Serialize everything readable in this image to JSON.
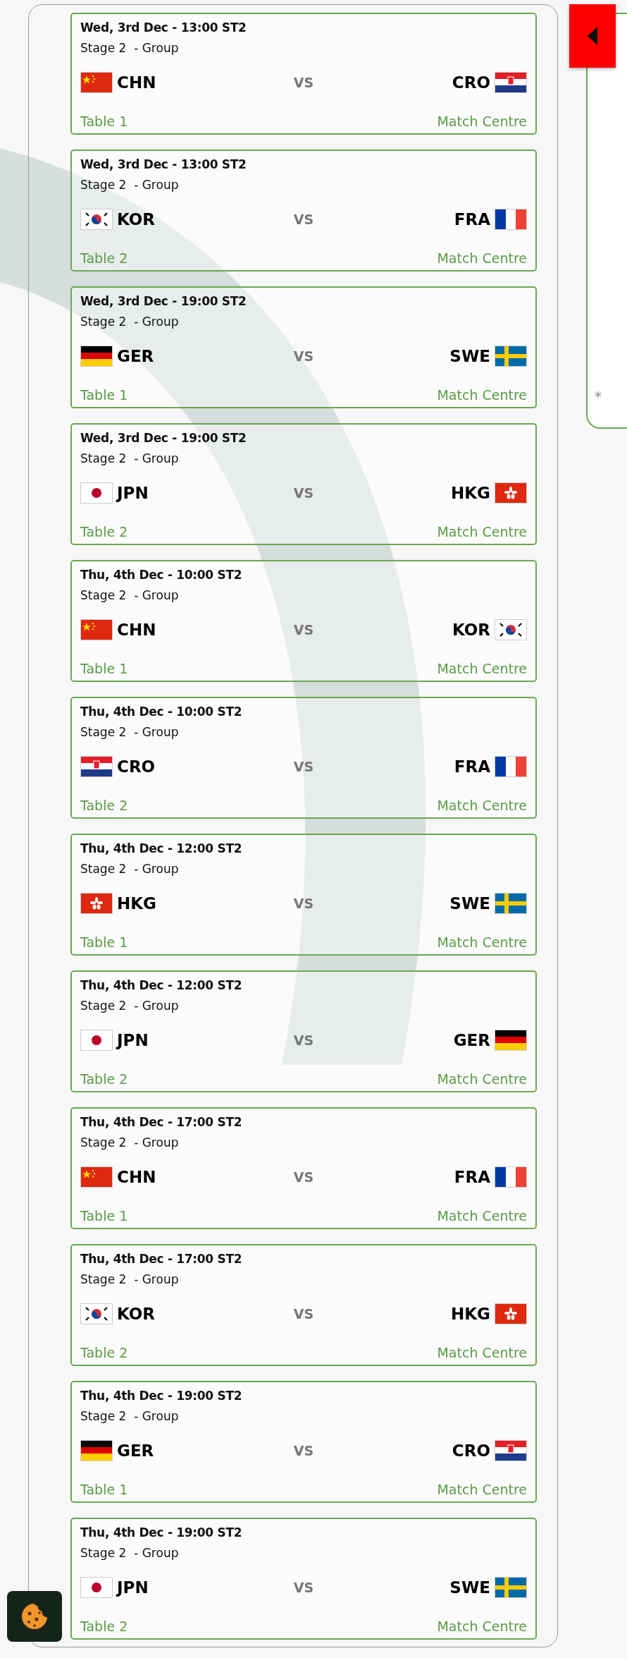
{
  "matches": [
    {
      "date": "Wed, 3rd Dec - 13:00 ST2",
      "stage": "Stage 2  - Group",
      "home": {
        "code": "CHN",
        "kind": "cn"
      },
      "vs": "VS",
      "away": {
        "code": "CRO",
        "kind": "hr"
      },
      "table": "Table 1",
      "link": "Match Centre"
    },
    {
      "date": "Wed, 3rd Dec - 13:00 ST2",
      "stage": "Stage 2  - Group",
      "home": {
        "code": "KOR",
        "kind": "kr"
      },
      "vs": "VS",
      "away": {
        "code": "FRA",
        "kind": "fr"
      },
      "table": "Table 2",
      "link": "Match Centre"
    },
    {
      "date": "Wed, 3rd Dec - 19:00 ST2",
      "stage": "Stage 2  - Group",
      "home": {
        "code": "GER",
        "kind": "de"
      },
      "vs": "VS",
      "away": {
        "code": "SWE",
        "kind": "se"
      },
      "table": "Table 1",
      "link": "Match Centre"
    },
    {
      "date": "Wed, 3rd Dec - 19:00 ST2",
      "stage": "Stage 2  - Group",
      "home": {
        "code": "JPN",
        "kind": "jp"
      },
      "vs": "VS",
      "away": {
        "code": "HKG",
        "kind": "hk"
      },
      "table": "Table 2",
      "link": "Match Centre"
    },
    {
      "date": "Thu, 4th Dec - 10:00 ST2",
      "stage": "Stage 2  - Group",
      "home": {
        "code": "CHN",
        "kind": "cn"
      },
      "vs": "VS",
      "away": {
        "code": "KOR",
        "kind": "kr"
      },
      "table": "Table 1",
      "link": "Match Centre"
    },
    {
      "date": "Thu, 4th Dec - 10:00 ST2",
      "stage": "Stage 2  - Group",
      "home": {
        "code": "CRO",
        "kind": "hr"
      },
      "vs": "VS",
      "away": {
        "code": "FRA",
        "kind": "fr"
      },
      "table": "Table 2",
      "link": "Match Centre"
    },
    {
      "date": "Thu, 4th Dec - 12:00 ST2",
      "stage": "Stage 2  - Group",
      "home": {
        "code": "HKG",
        "kind": "hk"
      },
      "vs": "VS",
      "away": {
        "code": "SWE",
        "kind": "se"
      },
      "table": "Table 1",
      "link": "Match Centre"
    },
    {
      "date": "Thu, 4th Dec - 12:00 ST2",
      "stage": "Stage 2  - Group",
      "home": {
        "code": "JPN",
        "kind": "jp"
      },
      "vs": "VS",
      "away": {
        "code": "GER",
        "kind": "de"
      },
      "table": "Table 2",
      "link": "Match Centre"
    },
    {
      "date": "Thu, 4th Dec - 17:00 ST2",
      "stage": "Stage 2  - Group",
      "home": {
        "code": "CHN",
        "kind": "cn"
      },
      "vs": "VS",
      "away": {
        "code": "FRA",
        "kind": "fr"
      },
      "table": "Table 1",
      "link": "Match Centre"
    },
    {
      "date": "Thu, 4th Dec - 17:00 ST2",
      "stage": "Stage 2  - Group",
      "home": {
        "code": "KOR",
        "kind": "kr"
      },
      "vs": "VS",
      "away": {
        "code": "HKG",
        "kind": "hk"
      },
      "table": "Table 2",
      "link": "Match Centre"
    },
    {
      "date": "Thu, 4th Dec - 19:00 ST2",
      "stage": "Stage 2  - Group",
      "home": {
        "code": "GER",
        "kind": "de"
      },
      "vs": "VS",
      "away": {
        "code": "CRO",
        "kind": "hr"
      },
      "table": "Table 1",
      "link": "Match Centre"
    },
    {
      "date": "Thu, 4th Dec - 19:00 ST2",
      "stage": "Stage 2  - Group",
      "home": {
        "code": "JPN",
        "kind": "jp"
      },
      "vs": "VS",
      "away": {
        "code": "SWE",
        "kind": "se"
      },
      "table": "Table 2",
      "link": "Match Centre"
    }
  ],
  "side_panel": {
    "footnote": "*"
  }
}
